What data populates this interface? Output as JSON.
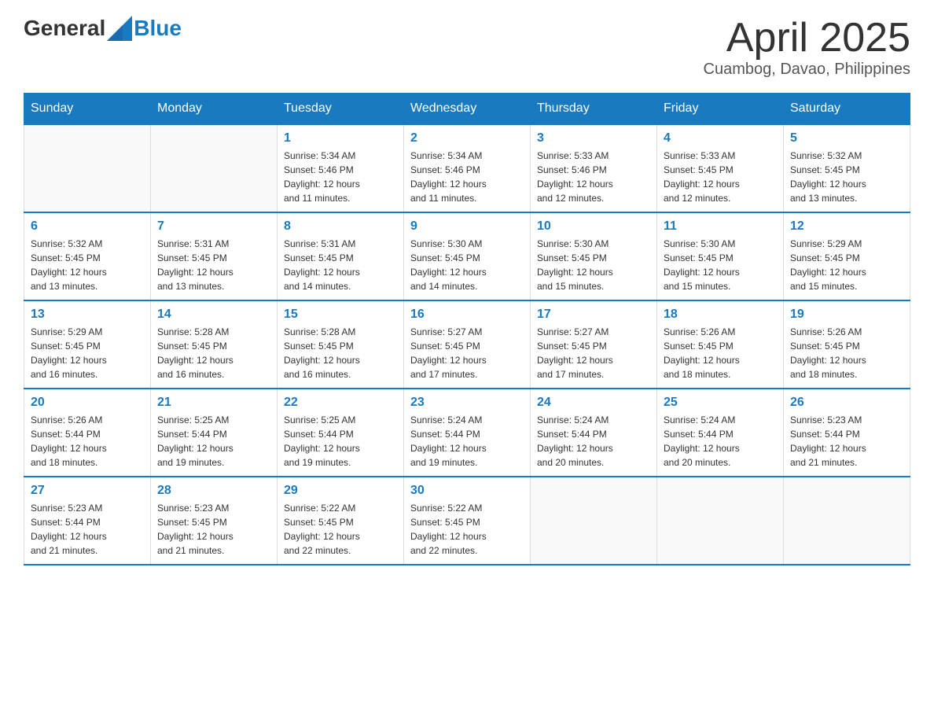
{
  "header": {
    "logo": {
      "text_general": "General",
      "text_blue": "Blue"
    },
    "title": "April 2025",
    "subtitle": "Cuambog, Davao, Philippines"
  },
  "calendar": {
    "days_of_week": [
      "Sunday",
      "Monday",
      "Tuesday",
      "Wednesday",
      "Thursday",
      "Friday",
      "Saturday"
    ],
    "weeks": [
      [
        {
          "day": "",
          "info": ""
        },
        {
          "day": "",
          "info": ""
        },
        {
          "day": "1",
          "info": "Sunrise: 5:34 AM\nSunset: 5:46 PM\nDaylight: 12 hours\nand 11 minutes."
        },
        {
          "day": "2",
          "info": "Sunrise: 5:34 AM\nSunset: 5:46 PM\nDaylight: 12 hours\nand 11 minutes."
        },
        {
          "day": "3",
          "info": "Sunrise: 5:33 AM\nSunset: 5:46 PM\nDaylight: 12 hours\nand 12 minutes."
        },
        {
          "day": "4",
          "info": "Sunrise: 5:33 AM\nSunset: 5:45 PM\nDaylight: 12 hours\nand 12 minutes."
        },
        {
          "day": "5",
          "info": "Sunrise: 5:32 AM\nSunset: 5:45 PM\nDaylight: 12 hours\nand 13 minutes."
        }
      ],
      [
        {
          "day": "6",
          "info": "Sunrise: 5:32 AM\nSunset: 5:45 PM\nDaylight: 12 hours\nand 13 minutes."
        },
        {
          "day": "7",
          "info": "Sunrise: 5:31 AM\nSunset: 5:45 PM\nDaylight: 12 hours\nand 13 minutes."
        },
        {
          "day": "8",
          "info": "Sunrise: 5:31 AM\nSunset: 5:45 PM\nDaylight: 12 hours\nand 14 minutes."
        },
        {
          "day": "9",
          "info": "Sunrise: 5:30 AM\nSunset: 5:45 PM\nDaylight: 12 hours\nand 14 minutes."
        },
        {
          "day": "10",
          "info": "Sunrise: 5:30 AM\nSunset: 5:45 PM\nDaylight: 12 hours\nand 15 minutes."
        },
        {
          "day": "11",
          "info": "Sunrise: 5:30 AM\nSunset: 5:45 PM\nDaylight: 12 hours\nand 15 minutes."
        },
        {
          "day": "12",
          "info": "Sunrise: 5:29 AM\nSunset: 5:45 PM\nDaylight: 12 hours\nand 15 minutes."
        }
      ],
      [
        {
          "day": "13",
          "info": "Sunrise: 5:29 AM\nSunset: 5:45 PM\nDaylight: 12 hours\nand 16 minutes."
        },
        {
          "day": "14",
          "info": "Sunrise: 5:28 AM\nSunset: 5:45 PM\nDaylight: 12 hours\nand 16 minutes."
        },
        {
          "day": "15",
          "info": "Sunrise: 5:28 AM\nSunset: 5:45 PM\nDaylight: 12 hours\nand 16 minutes."
        },
        {
          "day": "16",
          "info": "Sunrise: 5:27 AM\nSunset: 5:45 PM\nDaylight: 12 hours\nand 17 minutes."
        },
        {
          "day": "17",
          "info": "Sunrise: 5:27 AM\nSunset: 5:45 PM\nDaylight: 12 hours\nand 17 minutes."
        },
        {
          "day": "18",
          "info": "Sunrise: 5:26 AM\nSunset: 5:45 PM\nDaylight: 12 hours\nand 18 minutes."
        },
        {
          "day": "19",
          "info": "Sunrise: 5:26 AM\nSunset: 5:45 PM\nDaylight: 12 hours\nand 18 minutes."
        }
      ],
      [
        {
          "day": "20",
          "info": "Sunrise: 5:26 AM\nSunset: 5:44 PM\nDaylight: 12 hours\nand 18 minutes."
        },
        {
          "day": "21",
          "info": "Sunrise: 5:25 AM\nSunset: 5:44 PM\nDaylight: 12 hours\nand 19 minutes."
        },
        {
          "day": "22",
          "info": "Sunrise: 5:25 AM\nSunset: 5:44 PM\nDaylight: 12 hours\nand 19 minutes."
        },
        {
          "day": "23",
          "info": "Sunrise: 5:24 AM\nSunset: 5:44 PM\nDaylight: 12 hours\nand 19 minutes."
        },
        {
          "day": "24",
          "info": "Sunrise: 5:24 AM\nSunset: 5:44 PM\nDaylight: 12 hours\nand 20 minutes."
        },
        {
          "day": "25",
          "info": "Sunrise: 5:24 AM\nSunset: 5:44 PM\nDaylight: 12 hours\nand 20 minutes."
        },
        {
          "day": "26",
          "info": "Sunrise: 5:23 AM\nSunset: 5:44 PM\nDaylight: 12 hours\nand 21 minutes."
        }
      ],
      [
        {
          "day": "27",
          "info": "Sunrise: 5:23 AM\nSunset: 5:44 PM\nDaylight: 12 hours\nand 21 minutes."
        },
        {
          "day": "28",
          "info": "Sunrise: 5:23 AM\nSunset: 5:45 PM\nDaylight: 12 hours\nand 21 minutes."
        },
        {
          "day": "29",
          "info": "Sunrise: 5:22 AM\nSunset: 5:45 PM\nDaylight: 12 hours\nand 22 minutes."
        },
        {
          "day": "30",
          "info": "Sunrise: 5:22 AM\nSunset: 5:45 PM\nDaylight: 12 hours\nand 22 minutes."
        },
        {
          "day": "",
          "info": ""
        },
        {
          "day": "",
          "info": ""
        },
        {
          "day": "",
          "info": ""
        }
      ]
    ]
  }
}
